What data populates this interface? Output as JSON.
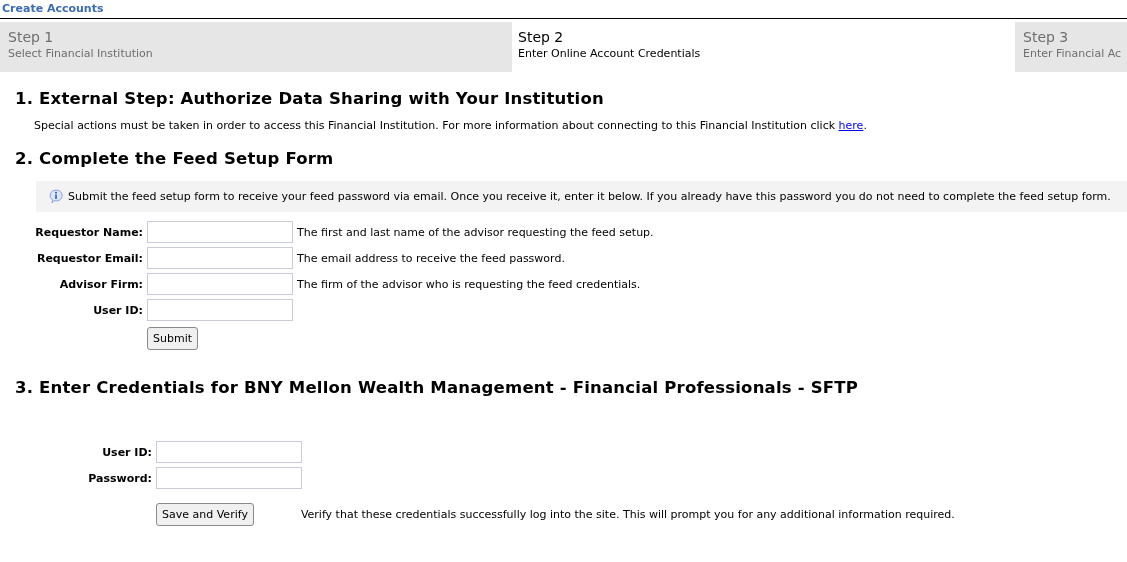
{
  "page_title": "Create Accounts",
  "tabs": [
    {
      "step": "Step 1",
      "label": "Select Financial Institution",
      "selected": false
    },
    {
      "step": "Step 2",
      "label": "Enter Online Account Credentials",
      "selected": true
    },
    {
      "step": "Step 3",
      "label": "Enter Financial Ac",
      "selected": false
    }
  ],
  "section_1": {
    "heading": "1. External Step: Authorize Data Sharing with Your Institution",
    "text": "Special actions must be taken in order to access this Financial Institution. For more information about connecting to this Financial Institution click",
    "link": "here",
    "after_link": "."
  },
  "section_2": {
    "heading": "2. Complete the Feed Setup Form",
    "info": "Submit the feed setup form to receive your feed password via email. Once you receive it, enter it below. If you already have this password you do not need to complete the feed setup form.",
    "fields": [
      {
        "label": "Requestor Name:",
        "hint": "The first and last name of the advisor requesting the feed setup."
      },
      {
        "label": "Requestor Email:",
        "hint": "The email address to receive the feed password."
      },
      {
        "label": "Advisor Firm:",
        "hint": "The firm of the advisor who is requesting the feed credentials."
      },
      {
        "label": "User ID:"
      }
    ],
    "button": "Submit"
  },
  "section_3": {
    "heading": "3. Enter Credentials for BNY Mellon Wealth Management - Financial Professionals - SFTP",
    "fields": [
      {
        "label": "User ID:"
      },
      {
        "label": "Password:"
      }
    ],
    "button": "Save and Verify",
    "button_note": "Verify that these credentials successfully log into the site. This will prompt you for any additional information required."
  }
}
